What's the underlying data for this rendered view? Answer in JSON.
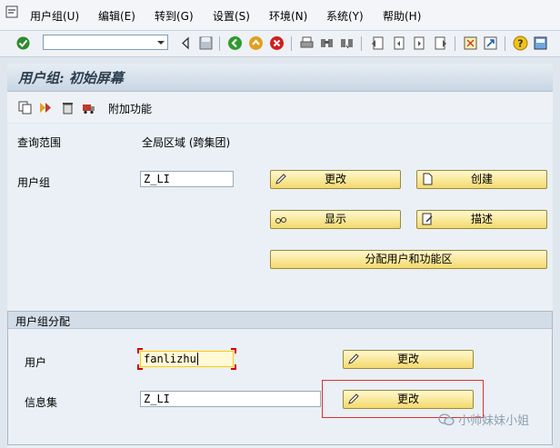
{
  "menu": {
    "items": [
      "用户组(U)",
      "编辑(E)",
      "转到(G)",
      "设置(S)",
      "环境(N)",
      "系统(Y)",
      "帮助(H)"
    ]
  },
  "toolbar": {
    "command_value": "",
    "icons": [
      "enter-icon",
      "back-icon",
      "exit-icon",
      "cancel-icon",
      "print-icon",
      "find-icon",
      "find-next-icon",
      "first-page-icon",
      "prev-page-icon",
      "next-page-icon",
      "last-page-icon",
      "new-session-icon",
      "shortcut-icon",
      "help-icon",
      "layout-icon"
    ]
  },
  "title": {
    "text": "用户组: 初始屏幕"
  },
  "app_toolbar": {
    "extras_label": "附加功能"
  },
  "form": {
    "scope_label": "查询范围",
    "scope_value": "全局区域 (跨集团)",
    "user_group_label": "用户组",
    "user_group_value": "Z_LI"
  },
  "buttons": {
    "change": "更改",
    "create": "创建",
    "display": "显示",
    "describe": "描述",
    "assign": "分配用户和功能区"
  },
  "group_box": {
    "title": "用户组分配",
    "user_label": "用户",
    "user_value": "fanlizhu",
    "user_change": "更改",
    "infoset_label": "信息集",
    "infoset_value": "Z_LI",
    "infoset_change": "更改"
  },
  "watermark": {
    "text": "小帅妹妹小姐"
  },
  "colors": {
    "button_top": "#fff9cf",
    "button_bottom": "#f4d96d",
    "highlight": "#e03030"
  }
}
